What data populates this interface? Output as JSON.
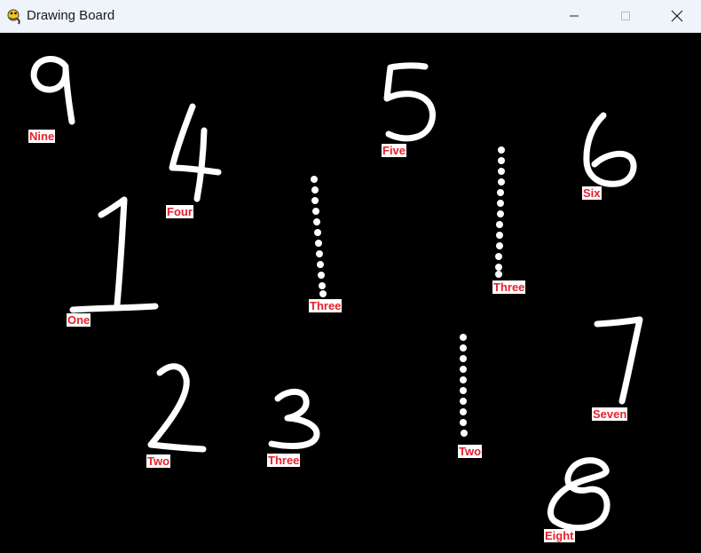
{
  "window": {
    "title": "Drawing Board",
    "app_icon": "pygame-snake-icon",
    "controls": {
      "minimize_icon": "minimize-icon",
      "maximize_icon": "maximize-icon",
      "close_icon": "close-icon"
    }
  },
  "canvas": {
    "background": "#000000",
    "stroke_color": "#ffffff",
    "label_text_color": "#e8212b",
    "label_background": "#ffffff"
  },
  "labels": {
    "nine": "Nine",
    "four": "Four",
    "one": "One",
    "five": "Five",
    "three_a": "Three",
    "three_b": "Three",
    "six": "Six",
    "seven": "Seven",
    "two_a": "Two",
    "three_c": "Three",
    "two_b": "Two",
    "eight": "Eight"
  }
}
